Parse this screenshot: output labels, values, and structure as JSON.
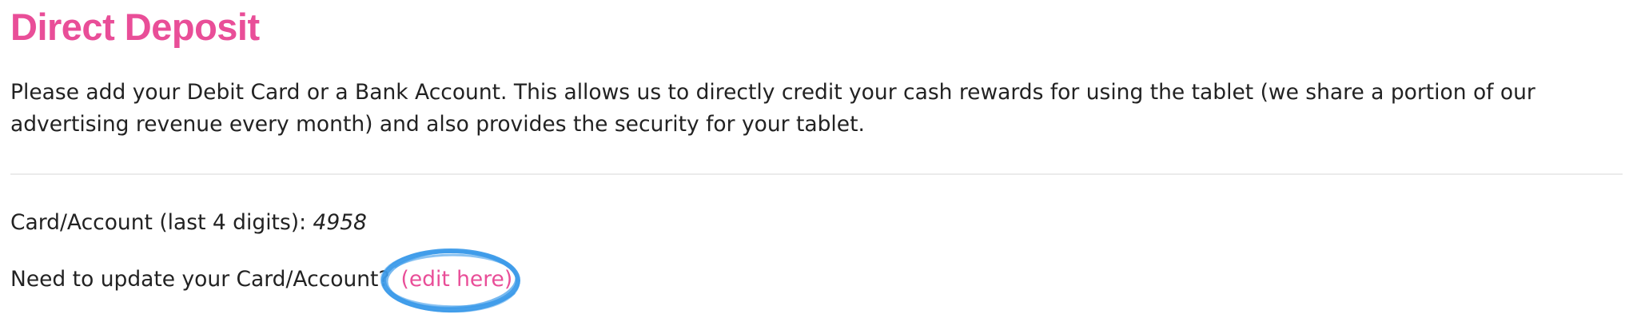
{
  "header": {
    "title": "Direct Deposit"
  },
  "intro": {
    "text": "Please add your Debit Card or a Bank Account. This allows us to directly credit your cash rewards for using the tablet (we share a portion of our advertising revenue every month) and also provides the security for your tablet."
  },
  "account": {
    "label": "Card/Account (last 4 digits):",
    "digits": "4958"
  },
  "update": {
    "prompt": "Need to update your Card/Account?",
    "link_label": "(edit here)"
  },
  "colors": {
    "accent": "#e94e98",
    "highlight_circle": "#3d9be9",
    "text": "#222222",
    "divider": "#ebebeb"
  }
}
